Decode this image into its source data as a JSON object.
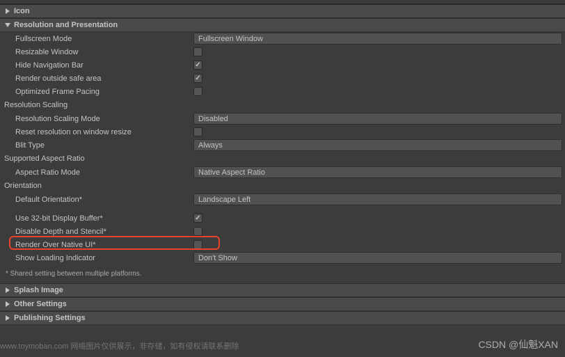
{
  "sections": {
    "icon": {
      "label": "Icon"
    },
    "resolution": {
      "label": "Resolution and Presentation",
      "fullscreenMode": {
        "label": "Fullscreen Mode",
        "value": "Fullscreen Window"
      },
      "resizableWindow": {
        "label": "Resizable Window",
        "checked": false
      },
      "hideNavBar": {
        "label": "Hide Navigation Bar",
        "checked": true
      },
      "renderOutsideSafe": {
        "label": "Render outside safe area",
        "checked": true
      },
      "optimizedFrame": {
        "label": "Optimized Frame Pacing",
        "checked": false
      },
      "resScaling": {
        "header": "Resolution Scaling"
      },
      "resScalingMode": {
        "label": "Resolution Scaling Mode",
        "value": "Disabled"
      },
      "resetRes": {
        "label": "Reset resolution on window resize",
        "checked": false
      },
      "blitType": {
        "label": "Blit Type",
        "value": "Always"
      },
      "supportedAspect": {
        "header": "Supported Aspect Ratio"
      },
      "aspectRatioMode": {
        "label": "Aspect Ratio Mode",
        "value": "Native Aspect Ratio"
      },
      "orientation": {
        "header": "Orientation"
      },
      "defaultOrientation": {
        "label": "Default Orientation*",
        "value": "Landscape Left"
      },
      "use32bit": {
        "label": "Use 32-bit Display Buffer*",
        "checked": true
      },
      "disableDepth": {
        "label": "Disable Depth and Stencil*",
        "checked": false
      },
      "renderOverNative": {
        "label": "Render Over Native UI*",
        "checked": false
      },
      "showLoading": {
        "label": "Show Loading Indicator",
        "value": "Don't Show"
      },
      "footnote": "* Shared setting between multiple platforms."
    },
    "splash": {
      "label": "Splash Image"
    },
    "other": {
      "label": "Other Settings"
    },
    "publishing": {
      "label": "Publishing Settings"
    }
  },
  "watermarks": {
    "csdn": "CSDN @仙魁XAN",
    "chinese": "www.toymoban.com 网络图片仅供展示，非存储，如有侵权请联系删除"
  }
}
